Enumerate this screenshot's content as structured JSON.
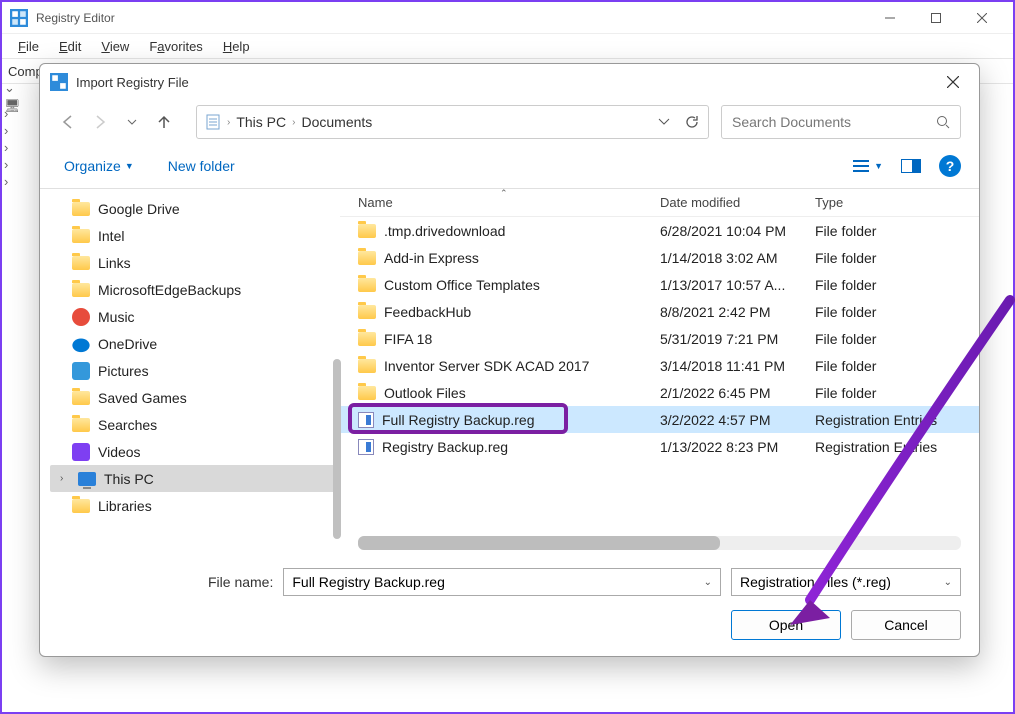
{
  "main_window": {
    "title": "Registry Editor",
    "menubar": [
      "File",
      "Edit",
      "View",
      "Favorites",
      "Help"
    ],
    "address_label_partial": "Comp",
    "tree_root": "C"
  },
  "dialog": {
    "title": "Import Registry File",
    "breadcrumb": {
      "root": "This PC",
      "folder": "Documents"
    },
    "search_placeholder": "Search Documents",
    "toolbar": {
      "organize": "Organize",
      "new_folder": "New folder"
    },
    "columns": {
      "name": "Name",
      "date": "Date modified",
      "type": "Type"
    },
    "sidebar": [
      {
        "label": "Google Drive",
        "icon": "folder"
      },
      {
        "label": "Intel",
        "icon": "folder"
      },
      {
        "label": "Links",
        "icon": "folder"
      },
      {
        "label": "MicrosoftEdgeBackups",
        "icon": "folder"
      },
      {
        "label": "Music",
        "icon": "music"
      },
      {
        "label": "OneDrive",
        "icon": "onedrive"
      },
      {
        "label": "Pictures",
        "icon": "pic"
      },
      {
        "label": "Saved Games",
        "icon": "folder"
      },
      {
        "label": "Searches",
        "icon": "folder"
      },
      {
        "label": "Videos",
        "icon": "vid"
      },
      {
        "label": "This PC",
        "icon": "pc",
        "selected": true
      },
      {
        "label": "Libraries",
        "icon": "folder"
      }
    ],
    "files": [
      {
        "name": ".tmp.drivedownload",
        "date": "6/28/2021 10:04 PM",
        "type": "File folder",
        "icon": "folder"
      },
      {
        "name": "Add-in Express",
        "date": "1/14/2018 3:02 AM",
        "type": "File folder",
        "icon": "folder"
      },
      {
        "name": "Custom Office Templates",
        "date": "1/13/2017 10:57 A...",
        "type": "File folder",
        "icon": "folder"
      },
      {
        "name": "FeedbackHub",
        "date": "8/8/2021 2:42 PM",
        "type": "File folder",
        "icon": "folder"
      },
      {
        "name": "FIFA 18",
        "date": "5/31/2019 7:21 PM",
        "type": "File folder",
        "icon": "folder"
      },
      {
        "name": "Inventor Server SDK ACAD 2017",
        "date": "3/14/2018 11:41 PM",
        "type": "File folder",
        "icon": "folder"
      },
      {
        "name": "Outlook Files",
        "date": "2/1/2022 6:45 PM",
        "type": "File folder",
        "icon": "folder"
      },
      {
        "name": "Full Registry Backup.reg",
        "date": "3/2/2022 4:57 PM",
        "type": "Registration Entries",
        "icon": "reg",
        "selected": true,
        "highlight": true
      },
      {
        "name": "Registry Backup.reg",
        "date": "1/13/2022 8:23 PM",
        "type": "Registration Entries",
        "icon": "reg"
      }
    ],
    "filename_label": "File name:",
    "filename_value": "Full Registry Backup.reg",
    "filter_value": "Registration Files (*.reg)",
    "open_btn": "Open",
    "cancel_btn": "Cancel"
  }
}
